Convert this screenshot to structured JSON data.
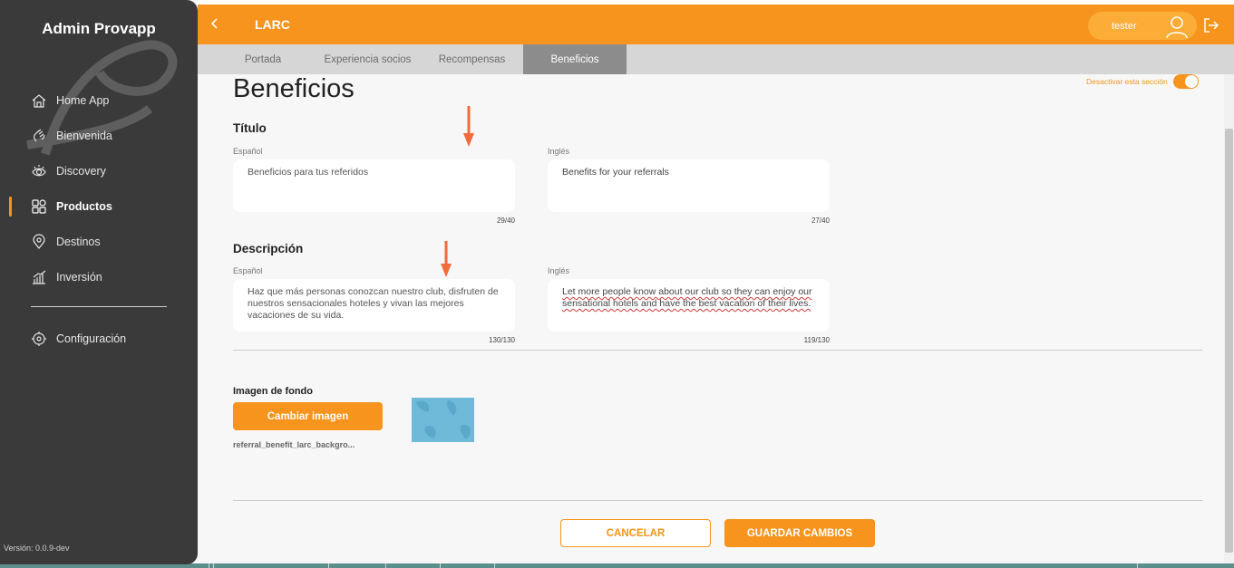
{
  "sidebar": {
    "brand": "Admin Provapp",
    "items": [
      {
        "label": "Home App",
        "icon": "home-icon"
      },
      {
        "label": "Bienvenida",
        "icon": "hand-wave-icon"
      },
      {
        "label": "Discovery",
        "icon": "eye-icon"
      },
      {
        "label": "Productos",
        "icon": "grid-icon",
        "active": true
      },
      {
        "label": "Destinos",
        "icon": "location-pin-icon"
      },
      {
        "label": "Inversión",
        "icon": "chart-icon"
      },
      {
        "label": "Configuración",
        "icon": "gear-icon"
      }
    ],
    "version": "Versión: 0.0.9-dev"
  },
  "header": {
    "title": "LARC",
    "user": "tester",
    "back_icon": "chevron-left-icon",
    "logout_icon": "logout-icon"
  },
  "tabs": [
    {
      "label": "Portada"
    },
    {
      "label": "Experiencia socios"
    },
    {
      "label": "Recompensas"
    },
    {
      "label": "Beneficios",
      "active": true
    }
  ],
  "main": {
    "title": "Beneficios",
    "toggle_label": "Desactivar esta sección",
    "toggle_on": true,
    "titulo": {
      "heading": "Título",
      "es_label": "Español",
      "en_label": "Inglés",
      "es_value": "Beneficios para tus referidos",
      "en_value": "Benefits for your referrals",
      "es_count": "29/40",
      "en_count": "27/40"
    },
    "descripcion": {
      "heading": "Descripción",
      "es_label": "Español",
      "en_label": "Inglés",
      "es_value": "Haz que más personas conozcan nuestro club, disfruten de nuestros sensacionales hoteles y vivan las mejores vacaciones de su vida.",
      "en_value": "Let more people know about our club so they can enjoy our sensational hotels and have the best vacation of their lives.",
      "es_count": "130/130",
      "en_count": "119/130"
    },
    "imagen": {
      "label": "Imagen de fondo",
      "button": "Cambiar imagen",
      "filename": "referral_benefit_larc_backgro..."
    },
    "cancel": "CANCELAR",
    "save": "GUARDAR CAMBIOS"
  },
  "colors": {
    "accent": "#f7941d",
    "sidebar": "#3a3a3a",
    "tab_active": "#8c8c8c",
    "arrow": "#f26b3a"
  }
}
